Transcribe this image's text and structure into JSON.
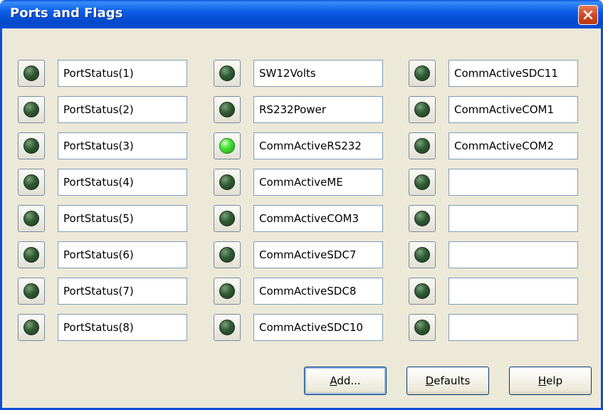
{
  "window": {
    "title": "Ports and Flags",
    "accent": "#0a4dd8",
    "face": "#ece9d8"
  },
  "columns": [
    {
      "rows": [
        {
          "label": "PortStatus(1)",
          "led": "off"
        },
        {
          "label": "PortStatus(2)",
          "led": "off"
        },
        {
          "label": "PortStatus(3)",
          "led": "off"
        },
        {
          "label": "PortStatus(4)",
          "led": "off"
        },
        {
          "label": "PortStatus(5)",
          "led": "off"
        },
        {
          "label": "PortStatus(6)",
          "led": "off"
        },
        {
          "label": "PortStatus(7)",
          "led": "off"
        },
        {
          "label": "PortStatus(8)",
          "led": "off"
        }
      ]
    },
    {
      "rows": [
        {
          "label": "SW12Volts",
          "led": "off"
        },
        {
          "label": "RS232Power",
          "led": "off"
        },
        {
          "label": "CommActiveRS232",
          "led": "on"
        },
        {
          "label": "CommActiveME",
          "led": "off"
        },
        {
          "label": "CommActiveCOM3",
          "led": "off"
        },
        {
          "label": "CommActiveSDC7",
          "led": "off"
        },
        {
          "label": "CommActiveSDC8",
          "led": "off"
        },
        {
          "label": "CommActiveSDC10",
          "led": "off"
        }
      ]
    },
    {
      "rows": [
        {
          "label": "CommActiveSDC11",
          "led": "off"
        },
        {
          "label": "CommActiveCOM1",
          "led": "off"
        },
        {
          "label": "CommActiveCOM2",
          "led": "off"
        },
        {
          "label": "",
          "led": "off"
        },
        {
          "label": "",
          "led": "off"
        },
        {
          "label": "",
          "led": "off"
        },
        {
          "label": "",
          "led": "off"
        },
        {
          "label": "",
          "led": "off"
        }
      ]
    }
  ],
  "buttons": {
    "add": {
      "prefix": "",
      "mnemonic": "A",
      "rest": "dd..."
    },
    "defaults": {
      "prefix": "",
      "mnemonic": "D",
      "rest": "efaults"
    },
    "help": {
      "prefix": "",
      "mnemonic": "H",
      "rest": "elp"
    }
  },
  "colors": {
    "led_on": "#46e034",
    "led_off": "#2f5a34",
    "close": "#c8431b"
  }
}
